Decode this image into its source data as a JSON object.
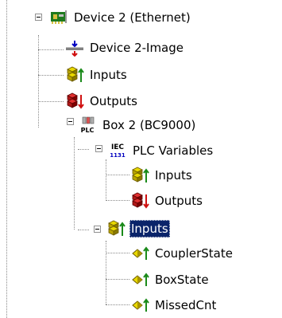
{
  "tree": {
    "device": {
      "label": "Device 2 (Ethernet)",
      "icon": "ethernet-card-icon"
    },
    "image": {
      "label": "Device 2-Image",
      "icon": "process-image-icon"
    },
    "device_inputs": {
      "label": "Inputs",
      "icon": "inputs-icon"
    },
    "device_outputs": {
      "label": "Outputs",
      "icon": "outputs-icon"
    },
    "box": {
      "label": "Box 2 (BC9000)",
      "icon": "plc-box-icon",
      "icon_text": "PLC"
    },
    "plc_variables": {
      "label": "PLC Variables",
      "icon": "iec-icon",
      "icon_text_top": "IEC",
      "icon_text_bottom": "1131"
    },
    "plc_inputs": {
      "label": "Inputs",
      "icon": "inputs-icon"
    },
    "plc_outputs": {
      "label": "Outputs",
      "icon": "outputs-icon"
    },
    "box_inputs": {
      "label": "Inputs",
      "icon": "inputs-icon",
      "selected": true
    },
    "coupler_state": {
      "label": "CouplerState",
      "icon": "variable-input-icon"
    },
    "box_state": {
      "label": "BoxState",
      "icon": "variable-input-icon"
    },
    "missed_cnt": {
      "label": "MissedCnt",
      "icon": "variable-input-icon"
    }
  },
  "colors": {
    "selection": "#0a246a",
    "tree_lines": "#8a8a8a",
    "input_arrow": "#1a8a1a",
    "output_arrow": "#d01010"
  }
}
